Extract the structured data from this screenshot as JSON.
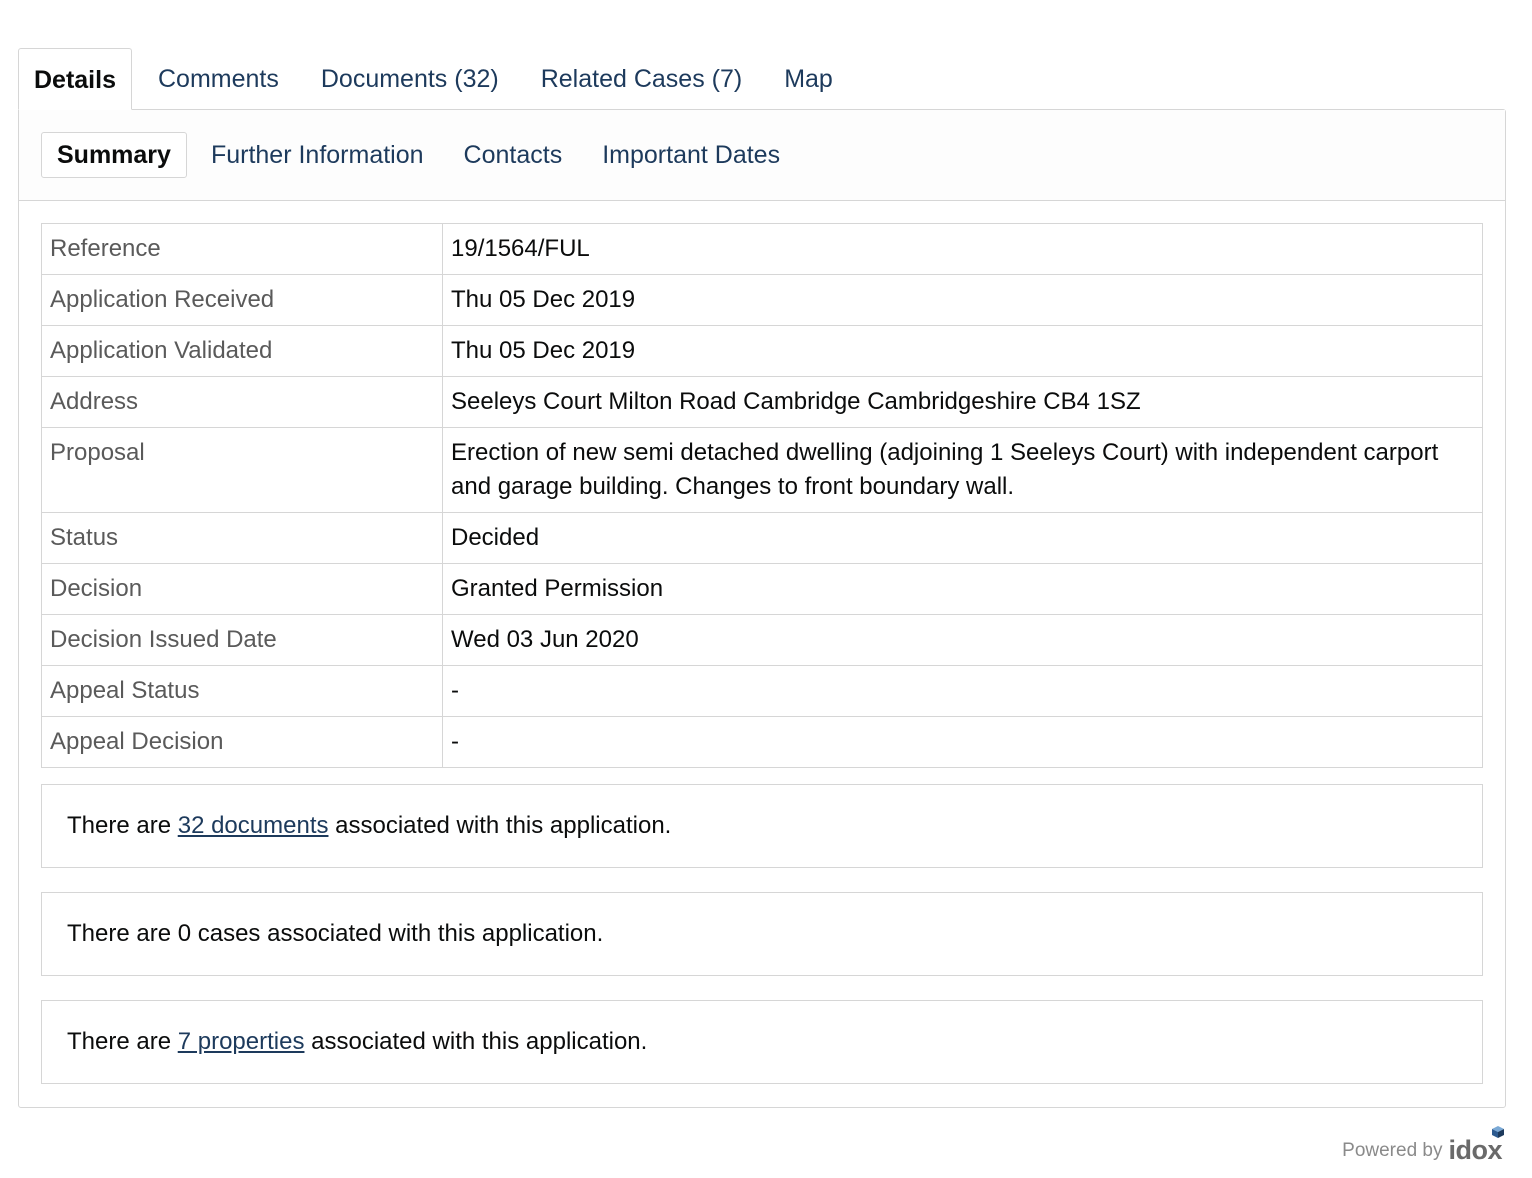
{
  "main_tabs": [
    {
      "label": "Details",
      "active": true
    },
    {
      "label": "Comments",
      "active": false
    },
    {
      "label": "Documents (32)",
      "active": false
    },
    {
      "label": "Related Cases (7)",
      "active": false
    },
    {
      "label": "Map",
      "active": false
    }
  ],
  "sub_tabs": [
    {
      "label": "Summary",
      "active": true
    },
    {
      "label": "Further Information",
      "active": false
    },
    {
      "label": "Contacts",
      "active": false
    },
    {
      "label": "Important Dates",
      "active": false
    }
  ],
  "summary": {
    "rows": [
      {
        "label": "Reference",
        "value": "19/1564/FUL"
      },
      {
        "label": "Application Received",
        "value": "Thu 05 Dec 2019"
      },
      {
        "label": "Application Validated",
        "value": "Thu 05 Dec 2019"
      },
      {
        "label": "Address",
        "value": "Seeleys Court Milton Road Cambridge Cambridgeshire CB4 1SZ"
      },
      {
        "label": "Proposal",
        "value": "Erection of new semi detached dwelling (adjoining 1 Seeleys Court) with independent carport and garage building. Changes to front boundary wall."
      },
      {
        "label": "Status",
        "value": "Decided"
      },
      {
        "label": "Decision",
        "value": "Granted Permission"
      },
      {
        "label": "Decision Issued Date",
        "value": "Wed 03 Jun 2020"
      },
      {
        "label": "Appeal Status",
        "value": "-"
      },
      {
        "label": "Appeal Decision",
        "value": "-"
      }
    ]
  },
  "documents_box": {
    "prefix": "There are ",
    "link": "32 documents",
    "suffix": " associated with this application."
  },
  "cases_box": {
    "text": "There are 0 cases associated with this application."
  },
  "properties_box": {
    "prefix": "There are ",
    "link": "7 properties",
    "suffix": " associated with this application."
  },
  "footer": {
    "powered_by": "Powered by",
    "brand": "idox"
  },
  "colors": {
    "link": "#1d3a5c",
    "border": "#d6d6d6",
    "label_text": "#5a5a5a"
  }
}
